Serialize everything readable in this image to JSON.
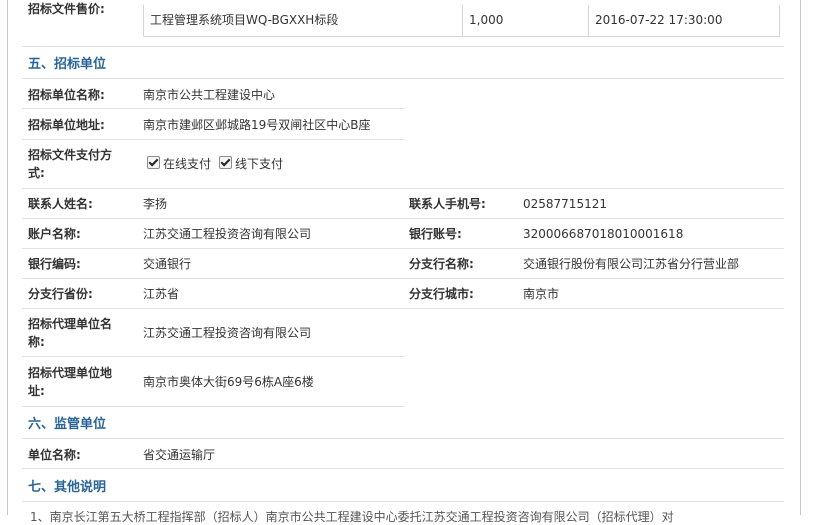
{
  "sale": {
    "label": "招标文件售价:",
    "row": {
      "section": "工程管理系统项目WQ-BGXXH标段",
      "price": "1,000",
      "deadline": "2016-07-22 17:30:00"
    }
  },
  "section5": {
    "title": "五、招标单位",
    "unit_name_label": "招标单位名称:",
    "unit_name": "南京市公共工程建设中心",
    "unit_address_label": "招标单位地址:",
    "unit_address": "南京市建邺区邺城路19号双闸社区中心B座",
    "payment_label_1": "招标文件支付方",
    "payment_label_2": "式:",
    "payment_online": "在线支付",
    "payment_offline": "线下支付",
    "contact_label": "联系人姓名:",
    "contact": "李扬",
    "phone_label": "联系人手机号:",
    "phone": "02587715121",
    "account_name_label": "账户名称:",
    "account_name": "江苏交通工程投资咨询有限公司",
    "account_no_label": "银行账号:",
    "account_no": "320006687018010001618",
    "bank_code_label": "银行编码:",
    "bank_code": "交通银行",
    "branch_name_label": "分支行名称:",
    "branch_name": "交通银行股份有限公司江苏省分行营业部",
    "branch_province_label": "分支行省份:",
    "branch_province": "江苏省",
    "branch_city_label": "分支行城市:",
    "branch_city": "南京市",
    "agent_name_label_1": "招标代理单位名",
    "agent_name_label_2": "称:",
    "agent_name": "江苏交通工程投资咨询有限公司",
    "agent_address_label_1": "招标代理单位地",
    "agent_address_label_2": "址:",
    "agent_address": "南京市奥体大街69号6栋A座6楼"
  },
  "section6": {
    "title": "六、监管单位",
    "unit_label": "单位名称:",
    "unit": "省交通运输厅"
  },
  "section7": {
    "title": "七、其他说明",
    "text_cut": "1、南京长江第五大桥工程指挥部（招标人）南京市公共工程建设中心委托江苏交通工程投资咨询有限公司（招标代理）对"
  }
}
